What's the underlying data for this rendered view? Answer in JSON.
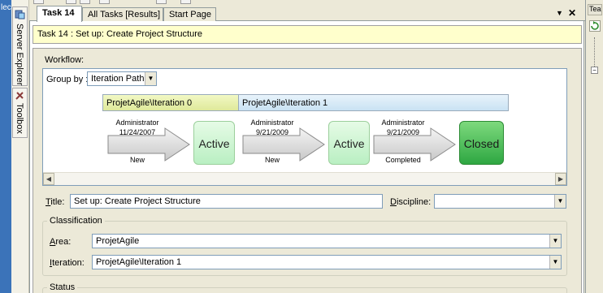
{
  "left_strip": {
    "text": "lec"
  },
  "side_dock": {
    "server_explorer_label": "Server Explorer",
    "toolbox_label": "Toolbox"
  },
  "tabs": [
    {
      "label": "Task 14",
      "active": true
    },
    {
      "label": "All Tasks [Results]",
      "active": false
    },
    {
      "label": "Start Page",
      "active": false
    }
  ],
  "tab_controls": {
    "dropdown_glyph": "▼",
    "close_glyph": "✕"
  },
  "work_item": {
    "title_bar": "Task 14 : Set up: Create Project Structure"
  },
  "workflow": {
    "label": "Workflow:",
    "group_by_label": "Group by :",
    "group_by_value": "Iteration Path",
    "iterations": [
      "ProjetAgile\\Iteration 0",
      "ProjetAgile\\Iteration 1"
    ],
    "transitions": [
      {
        "user": "Administrator",
        "date": "11/24/2007",
        "reason": "New"
      },
      {
        "user": "Administrator",
        "date": "9/21/2009",
        "reason": "New"
      },
      {
        "user": "Administrator",
        "date": "9/21/2009",
        "reason": "Completed"
      }
    ],
    "states": [
      "Active",
      "Active",
      "Closed"
    ]
  },
  "fields": {
    "title_label_u": "T",
    "title_label_rest": "itle:",
    "title_value": "Set up: Create Project Structure",
    "discipline_label_u": "D",
    "discipline_label_rest": "iscipline:",
    "discipline_value": "",
    "classification_label": "Classification",
    "area_label_u": "A",
    "area_label_rest": "rea:",
    "area_value": "ProjetAgile",
    "iteration_label_u": "I",
    "iteration_label_rest": "teration:",
    "iteration_value": "ProjetAgile\\Iteration 1",
    "status_label": "Status"
  },
  "right_panel": {
    "tab_text": "Tea"
  },
  "colors": {
    "title_bar_bg": "#ffffcc",
    "iteration0_band": "#e8f1b0",
    "iteration1_band": "#d6eaf7",
    "active_state": "#c9f3cf",
    "closed_state": "#3bb34a",
    "left_strip": "#3b73b9"
  }
}
